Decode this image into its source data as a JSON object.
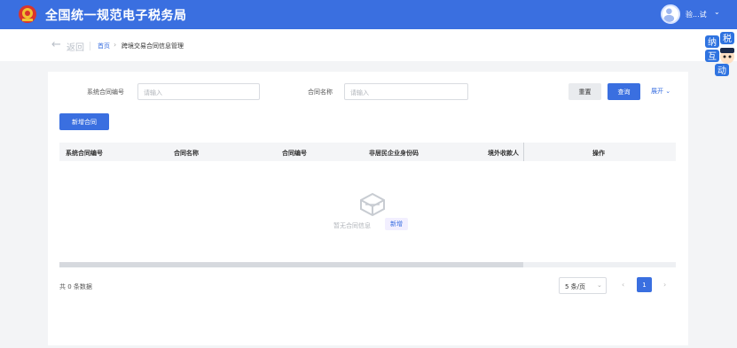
{
  "header": {
    "title": "全国统一规范电子税务局",
    "username": "验...试",
    "caret": "⌄"
  },
  "breadcrumb": {
    "back_arrow": "←",
    "back_label": "返回",
    "home": "首页",
    "separator": "›",
    "current": "跨境交易合同信息管理"
  },
  "mascot": {
    "chars": [
      "纳",
      "税",
      "互",
      "动"
    ]
  },
  "search": {
    "contract_no_label": "系统合同编号",
    "contract_no_placeholder": "请输入",
    "contract_name_label": "合同名称",
    "contract_name_placeholder": "请输入",
    "reset_label": "重置",
    "query_label": "查询",
    "expand_label": "展开 ⌄"
  },
  "actions": {
    "new_contract_label": "新增合同"
  },
  "table": {
    "columns": [
      "系统合同编号",
      "合同名称",
      "合同编号",
      "非居民企业身份码",
      "境外收款人",
      "操作"
    ],
    "rows": [],
    "empty_text": "暂无合同信息",
    "empty_add_label": "新增"
  },
  "pagination": {
    "total_text": "共 0 条数据",
    "page_size": "5 条/页",
    "page_size_caret": "⌄",
    "prev": "‹",
    "current_page": "1",
    "next": "›"
  },
  "colors": {
    "primary": "#3a6fe0",
    "header_bg": "#3a6fe0",
    "page_bg": "#f3f4f6"
  }
}
